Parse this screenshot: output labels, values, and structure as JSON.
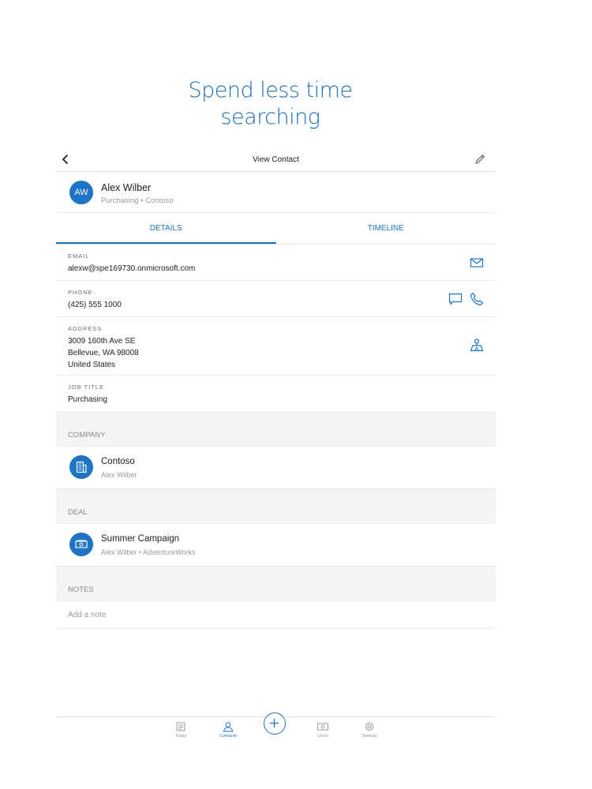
{
  "headline": {
    "line1": "Spend less time",
    "line2": "searching"
  },
  "navbar": {
    "title": "View Contact",
    "back_icon": "chevron-left-icon",
    "edit_icon": "pencil-icon"
  },
  "contact": {
    "initials": "AW",
    "name": "Alex Wilber",
    "subtitle": "Purchasing • Contoso"
  },
  "tabs": [
    {
      "label": "DETAILS",
      "active": true
    },
    {
      "label": "TIMELINE",
      "active": false
    }
  ],
  "fields": {
    "email": {
      "label": "EMAIL",
      "value": "alexw@spe169730.onmicrosoft.com"
    },
    "phone": {
      "label": "PHONE",
      "value": "(425) 555 1000"
    },
    "address": {
      "label": "ADDRESS",
      "line1": "3009 160th Ave SE",
      "line2": "Bellevue, WA 98008",
      "line3": "United States"
    },
    "job_title": {
      "label": "JOB TITLE",
      "value": "Purchasing"
    }
  },
  "company": {
    "header": "COMPANY",
    "title": "Contoso",
    "subtitle": "Alex Wilber"
  },
  "deal": {
    "header": "DEAL",
    "title": "Summer Campaign",
    "subtitle": "Alex Wilber • AdventureWorks"
  },
  "notes": {
    "header": "NOTES",
    "placeholder": "Add a note"
  },
  "tabbar": {
    "items": [
      {
        "label": "Today",
        "icon": "calendar-icon",
        "active": false
      },
      {
        "label": "Contacts",
        "icon": "person-icon",
        "active": true
      },
      {
        "label": "Users",
        "icon": "money-icon",
        "active": false
      },
      {
        "label": "Settings",
        "icon": "gear-icon",
        "active": false
      }
    ],
    "add_icon": "plus-icon"
  },
  "colors": {
    "accent": "#1d74c4",
    "headline": "#1b6fb5",
    "section_bg": "#f5f5f6"
  }
}
